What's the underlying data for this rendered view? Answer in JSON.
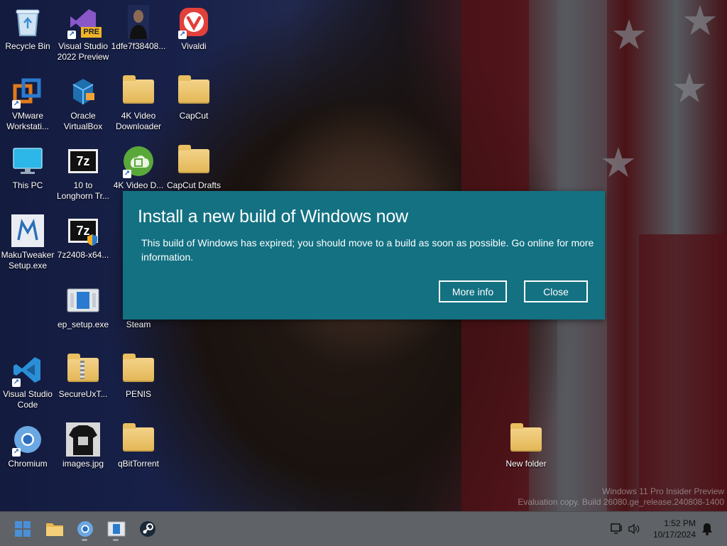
{
  "desktop": {
    "icons": [
      {
        "label": "Recycle Bin"
      },
      {
        "label": "Visual Studio 2022 Preview",
        "badge": "PRE"
      },
      {
        "label": "1dfe7f38408..."
      },
      {
        "label": "Vivaldi"
      },
      {
        "label": "VMware Workstati..."
      },
      {
        "label": "Oracle VirtualBox"
      },
      {
        "label": "4K Video Downloader"
      },
      {
        "label": "CapCut"
      },
      {
        "label": "This PC"
      },
      {
        "label": "10 to Longhorn Tr...",
        "glyph_text": "7z"
      },
      {
        "label": "4K Video D..."
      },
      {
        "label": "CapCut Drafts"
      },
      {
        "label": "MakuTweaker Setup.exe"
      },
      {
        "label": "7z2408-x64...",
        "glyph_text": "7z"
      },
      {
        "label": "ep_setup.exe"
      },
      {
        "label": "Steam"
      },
      {
        "label": "Visual Studio Code"
      },
      {
        "label": "SecureUxT..."
      },
      {
        "label": "PENIS"
      },
      {
        "label": "Chromium"
      },
      {
        "label": "images.jpg"
      },
      {
        "label": "qBitTorrent"
      },
      {
        "label": "New folder"
      }
    ]
  },
  "dialog": {
    "title": "Install a new build of Windows now",
    "message": "This build of Windows has expired; you should move to a build as soon as possible. Go online for more information.",
    "more_info_label": "More info",
    "close_label": "Close",
    "background_color": "#137182"
  },
  "watermark": {
    "line1": "Windows 11 Pro Insider Preview",
    "line2": "Evaluation copy. Build 26080.ge_release.240808-1400"
  },
  "taskbar": {
    "apps": [
      "start-icon",
      "file-explorer-icon",
      "chromium-icon",
      "ep-setup-icon",
      "steam-icon"
    ],
    "tray": {
      "time": "1:52 PM",
      "date": "10/17/2024"
    }
  }
}
